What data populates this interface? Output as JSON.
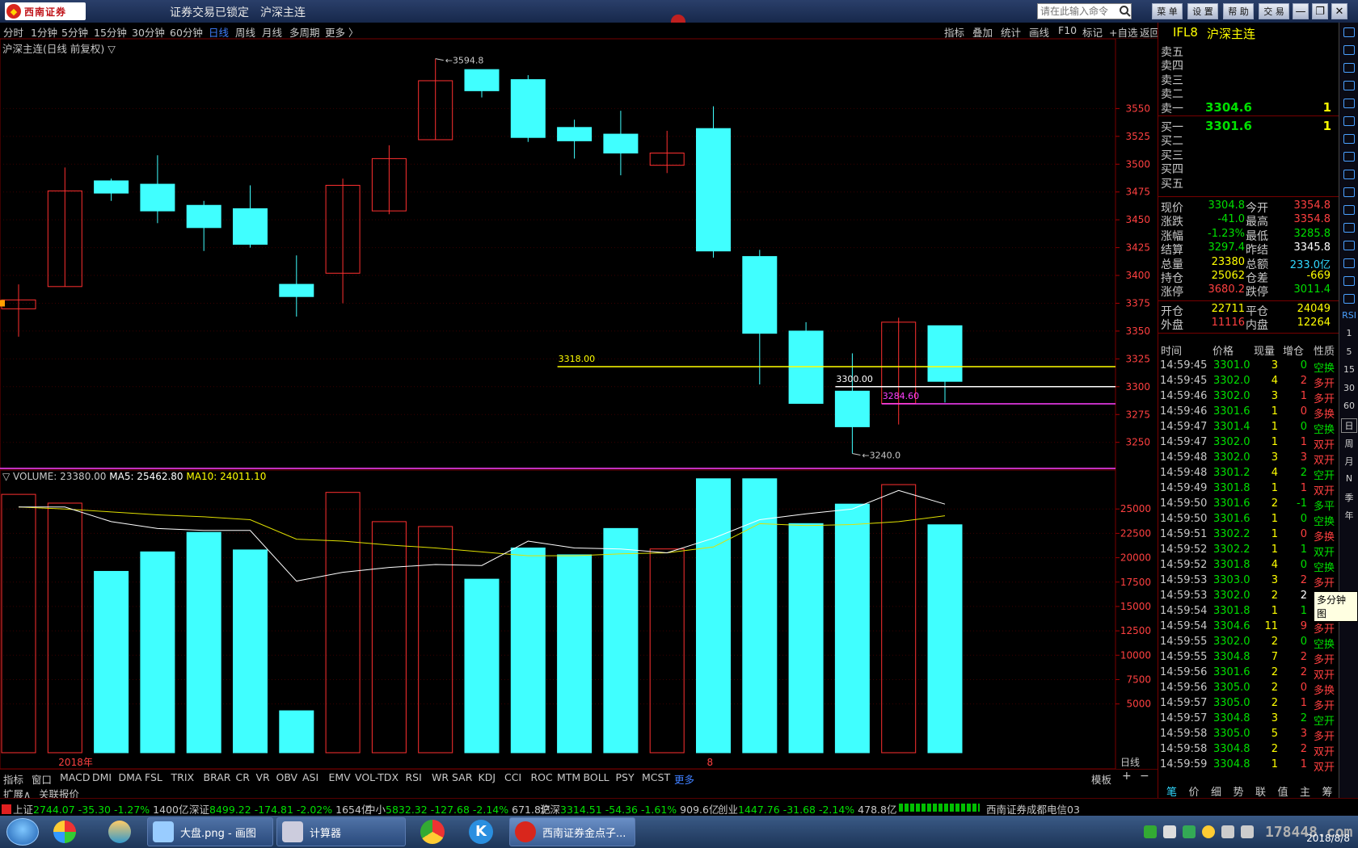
{
  "titlebar": {
    "brand": "西南证券",
    "lock_status": "证券交易已锁定",
    "instrument": "沪深主连",
    "cmd_placeholder": "请在此输入命令",
    "buttons": [
      "菜 单",
      "设 置",
      "帮 助",
      "交 易"
    ],
    "window_controls": [
      "—",
      "❐",
      "✕"
    ]
  },
  "periods": [
    {
      "label": "分时",
      "active": false
    },
    {
      "label": "1分钟",
      "active": false
    },
    {
      "label": "5分钟",
      "active": false
    },
    {
      "label": "15分钟",
      "active": false
    },
    {
      "label": "30分钟",
      "active": false
    },
    {
      "label": "60分钟",
      "active": false
    },
    {
      "label": "日线",
      "active": true
    },
    {
      "label": "周线",
      "active": false
    },
    {
      "label": "月线",
      "active": false
    },
    {
      "label": "多周期",
      "active": false
    },
    {
      "label": "更多 〉",
      "active": false
    }
  ],
  "chart_tools": [
    "指标",
    "叠加",
    "统计",
    "画线",
    "F10",
    "标记",
    "+自选",
    "返回"
  ],
  "chart_title": "沪深主连(日线 前复权) ▽",
  "volume_title": {
    "volume": "▽ VOLUME: 23380.00",
    "ma5": "MA5: 25462.80",
    "ma10": "MA10: 24011.10"
  },
  "chart_data": {
    "type": "candlestick",
    "price_axis": {
      "ticks": [
        3250,
        3275,
        3300,
        3325,
        3350,
        3375,
        3400,
        3425,
        3450,
        3475,
        3500,
        3525,
        3550
      ],
      "range": [
        3228,
        3604
      ]
    },
    "volume_axis": {
      "ticks": [
        5000,
        7500,
        10000,
        12500,
        15000,
        17500,
        20000,
        22500,
        25000
      ],
      "range": [
        0,
        28000
      ]
    },
    "x_labels": [
      {
        "label": "2018年",
        "index": 1
      },
      {
        "label": "8",
        "index": 15
      }
    ],
    "period_label": "日线",
    "candles": [
      {
        "o": 3370,
        "h": 3392,
        "l": 3345,
        "c": 3378,
        "v": 26500
      },
      {
        "o": 3390,
        "h": 3497,
        "l": 3390,
        "c": 3476,
        "v": 25600
      },
      {
        "o": 3485,
        "h": 3487,
        "l": 3467,
        "c": 3474,
        "v": 18600
      },
      {
        "o": 3482,
        "h": 3508,
        "l": 3447,
        "c": 3458,
        "v": 20600
      },
      {
        "o": 3463,
        "h": 3467,
        "l": 3422,
        "c": 3443,
        "v": 22600
      },
      {
        "o": 3460,
        "h": 3481,
        "l": 3425,
        "c": 3428,
        "v": 20800
      },
      {
        "o": 3392,
        "h": 3418,
        "l": 3363,
        "c": 3381,
        "v": 4300
      },
      {
        "o": 3402,
        "h": 3487,
        "l": 3375,
        "c": 3481,
        "v": 26700
      },
      {
        "o": 3458,
        "h": 3517,
        "l": 3455,
        "c": 3505,
        "v": 23700
      },
      {
        "o": 3522,
        "h": 3594.8,
        "l": 3522,
        "c": 3575,
        "v": 23200
      },
      {
        "o": 3585,
        "h": 3585,
        "l": 3560,
        "c": 3566,
        "v": 17800
      },
      {
        "o": 3576,
        "h": 3580,
        "l": 3520,
        "c": 3524,
        "v": 21000
      },
      {
        "o": 3533,
        "h": 3540,
        "l": 3505,
        "c": 3521,
        "v": 20300
      },
      {
        "o": 3527,
        "h": 3548,
        "l": 3490,
        "c": 3510,
        "v": 23000
      },
      {
        "o": 3499,
        "h": 3530,
        "l": 3492,
        "c": 3510,
        "v": 20900
      },
      {
        "o": 3532,
        "h": 3552,
        "l": 3416,
        "c": 3422,
        "v": 28100
      },
      {
        "o": 3417,
        "h": 3423,
        "l": 3302,
        "c": 3348,
        "v": 28100
      },
      {
        "o": 3350,
        "h": 3358,
        "l": 3285,
        "c": 3285,
        "v": 23500
      },
      {
        "o": 3296,
        "h": 3330,
        "l": 3240,
        "c": 3264,
        "v": 25500
      },
      {
        "o": 3285,
        "h": 3362,
        "l": 3266,
        "c": 3358,
        "v": 27500
      },
      {
        "o": 3354.8,
        "h": 3354.8,
        "l": 3285.8,
        "c": 3304.8,
        "v": 23380
      }
    ],
    "ma5": [
      25200,
      25200,
      23700,
      23000,
      22800,
      22800,
      17600,
      18500,
      19000,
      19300,
      19200,
      21700,
      21000,
      20900,
      20500,
      22000,
      23900,
      24500,
      25000,
      26900,
      25500
    ],
    "ma10": [
      25200,
      25000,
      24700,
      24400,
      24200,
      23900,
      21900,
      21700,
      21300,
      21000,
      20600,
      20200,
      20200,
      20400,
      20500,
      21100,
      23500,
      23300,
      23400,
      23700,
      24300
    ],
    "price_annotations": [
      {
        "label": "3594.8",
        "index": 9,
        "value": 3594.8
      },
      {
        "label": "3240.0",
        "index": 18,
        "value": 3240.0
      }
    ],
    "hlines": [
      {
        "label": "3318.00",
        "value": 3318,
        "color": "#ffff00",
        "from_index": 12
      },
      {
        "label": "3300.00",
        "value": 3300,
        "color": "#ffffff",
        "from_index": 18
      },
      {
        "label": "3284.60",
        "value": 3284.6,
        "color": "#ff40ff",
        "from_index": 19
      }
    ]
  },
  "indicators": [
    "指标",
    "窗口",
    "MACD",
    "DMI",
    "DMA",
    "FSL",
    "TRIX",
    "BRAR",
    "CR",
    "VR",
    "OBV",
    "ASI",
    "EMV",
    "VOL-TDX",
    "RSI",
    "WR",
    "SAR",
    "KDJ",
    "CCI",
    "ROC",
    "MTM",
    "BOLL",
    "PSY",
    "MCST",
    "更多"
  ],
  "indicator_selected": "更多",
  "template_label": "模板",
  "extra_tabs": [
    "扩展∧",
    "关联报价"
  ],
  "quote": {
    "code": "IFL8",
    "name": "沪深主连",
    "asks": [
      {
        "label": "卖五",
        "price": "",
        "vol": ""
      },
      {
        "label": "卖四",
        "price": "",
        "vol": ""
      },
      {
        "label": "卖三",
        "price": "",
        "vol": ""
      },
      {
        "label": "卖二",
        "price": "",
        "vol": ""
      },
      {
        "label": "卖一",
        "price": "3304.6",
        "vol": "1"
      }
    ],
    "bids": [
      {
        "label": "买一",
        "price": "3301.6",
        "vol": "1"
      },
      {
        "label": "买二",
        "price": "",
        "vol": ""
      },
      {
        "label": "买三",
        "price": "",
        "vol": ""
      },
      {
        "label": "买四",
        "price": "",
        "vol": ""
      },
      {
        "label": "买五",
        "price": "",
        "vol": ""
      }
    ],
    "stats": [
      {
        "l1": "现价",
        "v1": "3304.8",
        "c1": "green",
        "l2": "今开",
        "v2": "3354.8",
        "c2": "red"
      },
      {
        "l1": "涨跌",
        "v1": "-41.0",
        "c1": "green",
        "l2": "最高",
        "v2": "3354.8",
        "c2": "red"
      },
      {
        "l1": "涨幅",
        "v1": "-1.23%",
        "c1": "green",
        "l2": "最低",
        "v2": "3285.8",
        "c2": "green"
      },
      {
        "l1": "结算",
        "v1": "3297.4",
        "c1": "green",
        "l2": "昨结",
        "v2": "3345.8",
        "c2": "white"
      },
      {
        "l1": "总量",
        "v1": "23380",
        "c1": "yellow",
        "l2": "总额",
        "v2": "233.0亿",
        "c2": "cyan"
      },
      {
        "l1": "持仓",
        "v1": "25062",
        "c1": "yellow",
        "l2": "仓差",
        "v2": "-669",
        "c2": "yellow"
      },
      {
        "l1": "涨停",
        "v1": "3680.2",
        "c1": "red",
        "l2": "跌停",
        "v2": "3011.4",
        "c2": "green"
      }
    ],
    "stats2": [
      {
        "l1": "开仓",
        "v1": "22711",
        "c1": "yellow",
        "l2": "平仓",
        "v2": "24049",
        "c2": "yellow"
      },
      {
        "l1": "外盘",
        "v1": "11116",
        "c1": "red",
        "l2": "内盘",
        "v2": "12264",
        "c2": "yellow"
      }
    ],
    "tick_headers": [
      "时间",
      "价格",
      "现量",
      "增仓",
      "性质"
    ],
    "ticks": [
      {
        "t": "14:59:45",
        "p": "3301.0",
        "pc": "green",
        "v": "3",
        "d": "0",
        "dc": "green",
        "n": "空换",
        "nc": "green"
      },
      {
        "t": "14:59:45",
        "p": "3302.0",
        "pc": "green",
        "v": "4",
        "d": "2",
        "dc": "red",
        "n": "多开",
        "nc": "red"
      },
      {
        "t": "14:59:46",
        "p": "3302.0",
        "pc": "green",
        "v": "3",
        "d": "1",
        "dc": "red",
        "n": "多开",
        "nc": "red"
      },
      {
        "t": "14:59:46",
        "p": "3301.6",
        "pc": "green",
        "v": "1",
        "d": "0",
        "dc": "red",
        "n": "多换",
        "nc": "red"
      },
      {
        "t": "14:59:47",
        "p": "3301.4",
        "pc": "green",
        "v": "1",
        "d": "0",
        "dc": "green",
        "n": "空换",
        "nc": "green"
      },
      {
        "t": "14:59:47",
        "p": "3302.0",
        "pc": "green",
        "v": "1",
        "d": "1",
        "dc": "red",
        "n": "双开",
        "nc": "red"
      },
      {
        "t": "14:59:48",
        "p": "3302.0",
        "pc": "green",
        "v": "3",
        "d": "3",
        "dc": "red",
        "n": "双开",
        "nc": "red"
      },
      {
        "t": "14:59:48",
        "p": "3301.2",
        "pc": "green",
        "v": "4",
        "d": "2",
        "dc": "green",
        "n": "空开",
        "nc": "green"
      },
      {
        "t": "14:59:49",
        "p": "3301.8",
        "pc": "green",
        "v": "1",
        "d": "1",
        "dc": "red",
        "n": "双开",
        "nc": "red"
      },
      {
        "t": "14:59:50",
        "p": "3301.6",
        "pc": "green",
        "v": "2",
        "d": "-1",
        "dc": "green",
        "n": "多平",
        "nc": "green"
      },
      {
        "t": "14:59:50",
        "p": "3301.6",
        "pc": "green",
        "v": "1",
        "d": "0",
        "dc": "green",
        "n": "空换",
        "nc": "green"
      },
      {
        "t": "14:59:51",
        "p": "3302.2",
        "pc": "green",
        "v": "1",
        "d": "0",
        "dc": "red",
        "n": "多换",
        "nc": "red"
      },
      {
        "t": "14:59:52",
        "p": "3302.2",
        "pc": "green",
        "v": "1",
        "d": "1",
        "dc": "green",
        "n": "双开",
        "nc": "green"
      },
      {
        "t": "14:59:52",
        "p": "3301.8",
        "pc": "green",
        "v": "4",
        "d": "0",
        "dc": "green",
        "n": "空换",
        "nc": "green"
      },
      {
        "t": "14:59:53",
        "p": "3303.0",
        "pc": "green",
        "v": "3",
        "d": "2",
        "dc": "red",
        "n": "多开",
        "nc": "red"
      },
      {
        "t": "14:59:53",
        "p": "3302.0",
        "pc": "green",
        "v": "2",
        "d": "2",
        "dc": "white",
        "n": "",
        "nc": "white"
      },
      {
        "t": "14:59:54",
        "p": "3301.8",
        "pc": "green",
        "v": "1",
        "d": "1",
        "dc": "green",
        "n": "双开",
        "nc": "green"
      },
      {
        "t": "14:59:54",
        "p": "3304.6",
        "pc": "green",
        "v": "11",
        "d": "9",
        "dc": "red",
        "n": "多开",
        "nc": "red"
      },
      {
        "t": "14:59:55",
        "p": "3302.0",
        "pc": "green",
        "v": "2",
        "d": "0",
        "dc": "green",
        "n": "空换",
        "nc": "green"
      },
      {
        "t": "14:59:55",
        "p": "3304.8",
        "pc": "green",
        "v": "7",
        "d": "2",
        "dc": "red",
        "n": "多开",
        "nc": "red"
      },
      {
        "t": "14:59:56",
        "p": "3301.6",
        "pc": "green",
        "v": "2",
        "d": "2",
        "dc": "red",
        "n": "双开",
        "nc": "red"
      },
      {
        "t": "14:59:56",
        "p": "3305.0",
        "pc": "green",
        "v": "2",
        "d": "0",
        "dc": "red",
        "n": "多换",
        "nc": "red"
      },
      {
        "t": "14:59:57",
        "p": "3305.0",
        "pc": "green",
        "v": "2",
        "d": "1",
        "dc": "red",
        "n": "多开",
        "nc": "red"
      },
      {
        "t": "14:59:57",
        "p": "3304.8",
        "pc": "green",
        "v": "3",
        "d": "2",
        "dc": "green",
        "n": "空开",
        "nc": "green"
      },
      {
        "t": "14:59:58",
        "p": "3305.0",
        "pc": "green",
        "v": "5",
        "d": "3",
        "dc": "red",
        "n": "多开",
        "nc": "red"
      },
      {
        "t": "14:59:58",
        "p": "3304.8",
        "pc": "green",
        "v": "2",
        "d": "2",
        "dc": "red",
        "n": "双开",
        "nc": "red"
      },
      {
        "t": "14:59:59",
        "p": "3304.8",
        "pc": "green",
        "v": "1",
        "d": "1",
        "dc": "red",
        "n": "双开",
        "nc": "red"
      }
    ],
    "bottom_tabs": [
      "笔",
      "价",
      "细",
      "势",
      "联",
      "值",
      "主",
      "筹"
    ]
  },
  "side_tools": [
    "RSI",
    "1",
    "5",
    "15",
    "30",
    "60",
    "日",
    "周",
    "月",
    "N",
    "季",
    "年"
  ],
  "tooltip": "多分钟图",
  "statusbar": [
    {
      "name": "上证",
      "price": "2744.07",
      "chg": "-35.30",
      "pct": "-1.27%",
      "amt": "1400亿"
    },
    {
      "name": "深证",
      "price": "8499.22",
      "chg": "-174.81",
      "pct": "-2.02%",
      "amt": "1654亿"
    },
    {
      "name": "中小",
      "price": "5832.32",
      "chg": "-127.68",
      "pct": "-2.14%",
      "amt": "671.8亿"
    },
    {
      "name": "沪深",
      "price": "3314.51",
      "chg": "-54.36",
      "pct": "-1.61%",
      "amt": "909.6亿"
    },
    {
      "name": "创业",
      "price": "1447.76",
      "chg": "-31.68",
      "pct": "-2.14%",
      "amt": "478.8亿"
    }
  ],
  "broker_server": "西南证券成都电信03",
  "taskbar": {
    "items": [
      "大盘.png - 画图",
      "计算器",
      "西南证券金点子..."
    ],
    "watermark": "178448.com",
    "date": "2018/8/8"
  }
}
